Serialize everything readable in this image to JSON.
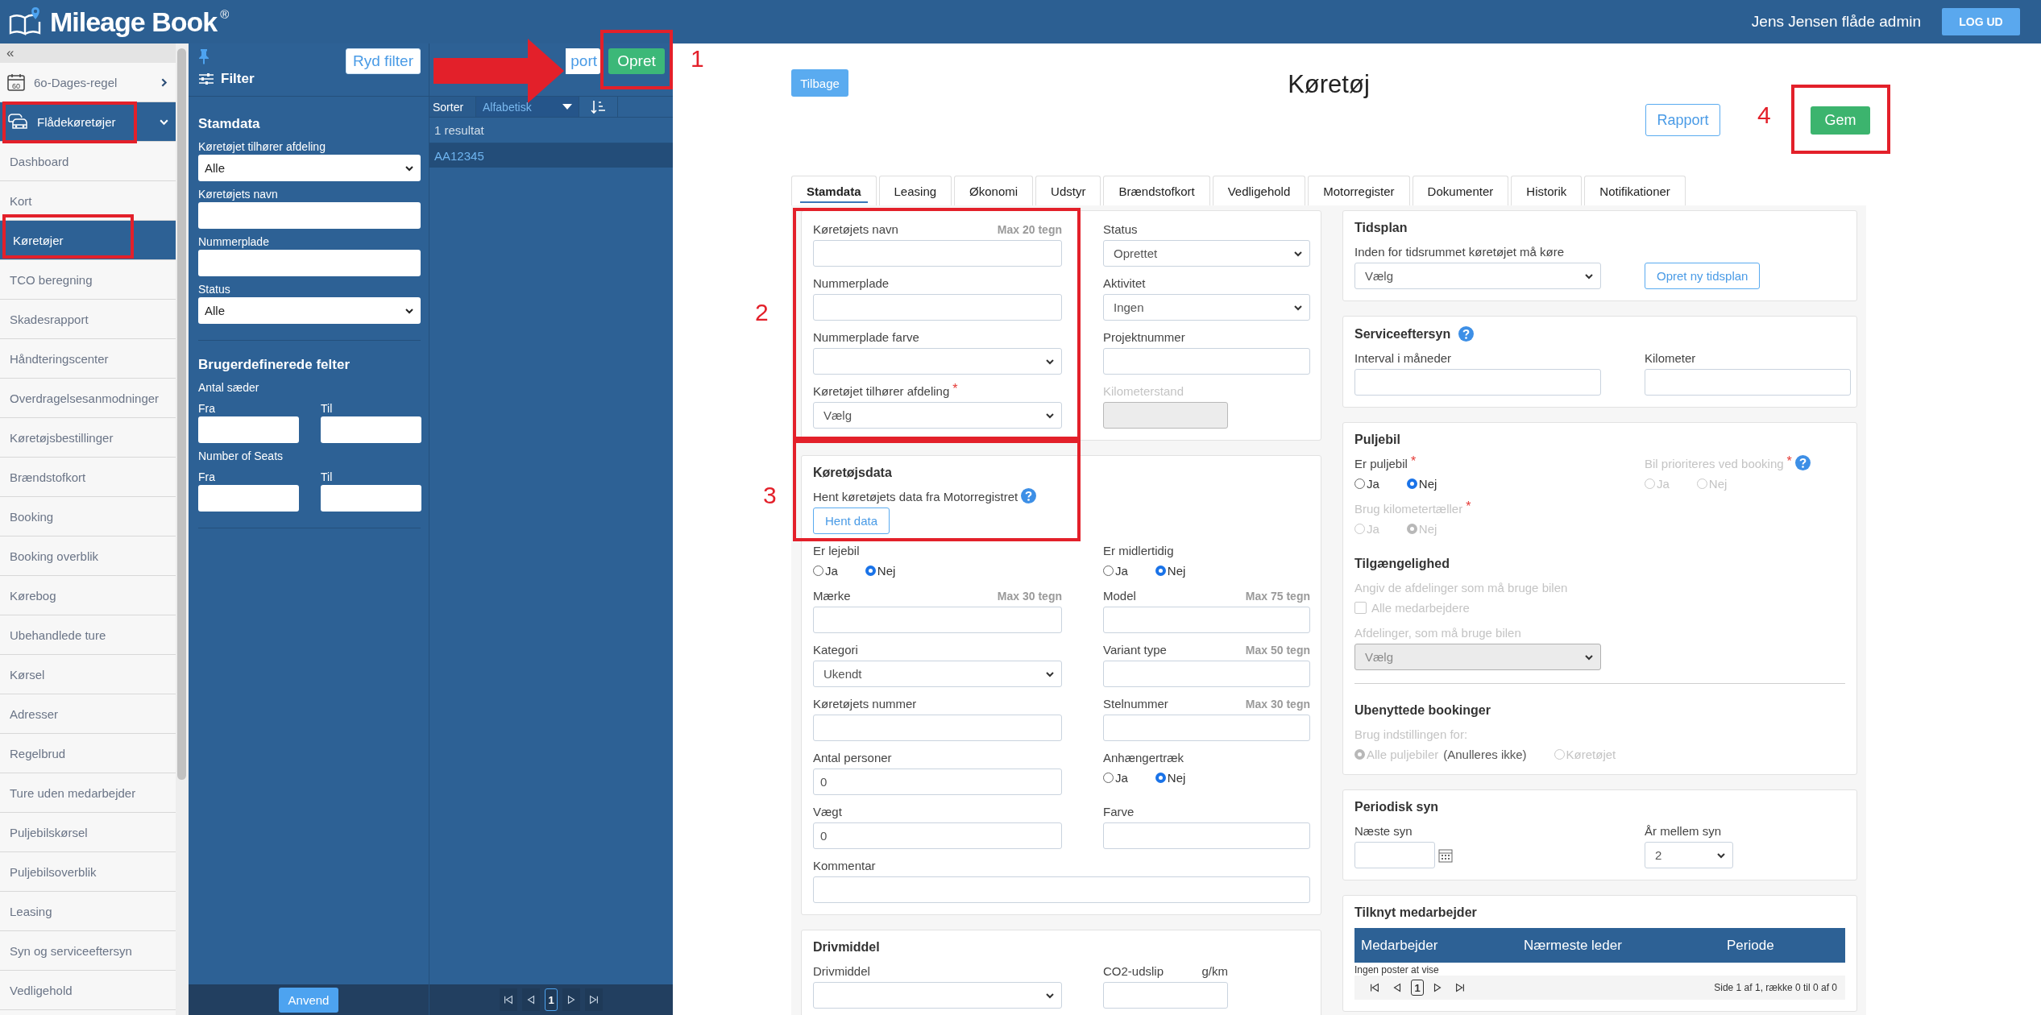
{
  "header": {
    "logo": "Mileage Book",
    "logo_mark": "®",
    "user": "Jens Jensen flåde admin",
    "logout": "LOG UD"
  },
  "sidebar": {
    "collapse": "«",
    "items": [
      {
        "kind": "group",
        "label": "6o-Dages-regel",
        "icon_text": "60",
        "expanded": false
      },
      {
        "kind": "group",
        "label": "Flådekøretøjer",
        "expanded": true
      },
      {
        "kind": "link",
        "label": "Dashboard",
        "selected": false
      },
      {
        "kind": "link",
        "label": "Kort",
        "selected": false
      },
      {
        "kind": "link",
        "label": "Køretøjer",
        "selected": true
      },
      {
        "kind": "link",
        "label": "TCO beregning",
        "selected": false
      },
      {
        "kind": "link",
        "label": "Skadesrapport",
        "selected": false
      },
      {
        "kind": "link",
        "label": "Håndteringscenter",
        "selected": false
      },
      {
        "kind": "link",
        "label": "Overdragelsesanmodninger",
        "selected": false
      },
      {
        "kind": "link",
        "label": "Køretøjsbestillinger",
        "selected": false
      },
      {
        "kind": "link",
        "label": "Brændstofkort",
        "selected": false
      },
      {
        "kind": "link",
        "label": "Booking",
        "selected": false
      },
      {
        "kind": "link",
        "label": "Booking overblik",
        "selected": false
      },
      {
        "kind": "link",
        "label": "Kørebog",
        "selected": false
      },
      {
        "kind": "link",
        "label": "Ubehandlede ture",
        "selected": false
      },
      {
        "kind": "link",
        "label": "Kørsel",
        "selected": false
      },
      {
        "kind": "link",
        "label": "Adresser",
        "selected": false
      },
      {
        "kind": "link",
        "label": "Regelbrud",
        "selected": false
      },
      {
        "kind": "link",
        "label": "Ture uden medarbejder",
        "selected": false
      },
      {
        "kind": "link",
        "label": "Puljebilskørsel",
        "selected": false
      },
      {
        "kind": "link",
        "label": "Puljebilsoverblik",
        "selected": false
      },
      {
        "kind": "link",
        "label": "Leasing",
        "selected": false
      },
      {
        "kind": "link",
        "label": "Syn og serviceeftersyn",
        "selected": false
      },
      {
        "kind": "link",
        "label": "Vedligehold",
        "selected": false
      }
    ]
  },
  "filter": {
    "clear": "Ryd filter",
    "title": "Filter",
    "sections": [
      {
        "title": "Stamdata",
        "fields": [
          {
            "kind": "select",
            "label": "Køretøjet tilhører afdeling",
            "value": "Alle"
          },
          {
            "kind": "text",
            "label": "Køretøjets navn"
          },
          {
            "kind": "text",
            "label": "Nummerplade"
          },
          {
            "kind": "select",
            "label": "Status",
            "value": "Alle"
          }
        ]
      },
      {
        "title": "Brugerdefinerede felter",
        "fields": [
          {
            "kind": "range",
            "label": "Antal sæder",
            "from": "Fra",
            "to": "Til"
          },
          {
            "kind": "range",
            "label": "Number of Seats",
            "from": "Fra",
            "to": "Til"
          }
        ]
      }
    ],
    "apply": "Anvend"
  },
  "results": {
    "export": "port",
    "create": "Opret",
    "sort_label": "Sorter",
    "sort_value": "Alfabetisk",
    "count": "1 resultat",
    "rows": [
      {
        "label": "AA12345",
        "selected": true
      }
    ],
    "page": "1"
  },
  "main": {
    "back": "Tilbage",
    "title": "Køretøj",
    "report": "Rapport",
    "save": "Gem",
    "tabs": [
      {
        "label": "Stamdata",
        "selected": true
      },
      {
        "label": "Leasing",
        "selected": false
      },
      {
        "label": "Økonomi",
        "selected": false
      },
      {
        "label": "Udstyr",
        "selected": false
      },
      {
        "label": "Brændstofkort",
        "selected": false
      },
      {
        "label": "Vedligehold",
        "selected": false
      },
      {
        "label": "Motorregister",
        "selected": false
      },
      {
        "label": "Dokumenter",
        "selected": false
      },
      {
        "label": "Historik",
        "selected": false
      },
      {
        "label": "Notifikationer",
        "selected": false
      }
    ],
    "left_cards": [
      {
        "rows": [
          {
            "kind": "fields",
            "fields": [
              {
                "kind": "text",
                "label": "Køretøjets navn",
                "hint": "Max 20 tegn"
              },
              {
                "kind": "select",
                "label": "Status",
                "value": "Oprettet"
              }
            ]
          },
          {
            "kind": "fields",
            "fields": [
              {
                "kind": "text",
                "label": "Nummerplade"
              },
              {
                "kind": "select",
                "label": "Aktivitet",
                "value": "Ingen"
              }
            ]
          },
          {
            "kind": "fields",
            "fields": [
              {
                "kind": "select",
                "label": "Nummerplade farve"
              },
              {
                "kind": "text",
                "label": "Projektnummer"
              }
            ]
          },
          {
            "kind": "fields",
            "fields": [
              {
                "kind": "select",
                "label": "Køretøjet tilhører afdeling",
                "required_mark": "*",
                "value": "Vælg"
              },
              {
                "kind": "text",
                "label": "Kilometerstand",
                "disabled": true,
                "short": true
              }
            ]
          }
        ]
      },
      {
        "title": "Køretøjsdata",
        "rows": [
          {
            "kind": "fields",
            "fields": [
              {
                "kind": "action",
                "label": "Hent køretøjets data fra Motorregistret",
                "help": true,
                "button": "Hent data"
              }
            ]
          },
          {
            "kind": "fields",
            "fields": [
              {
                "kind": "radio",
                "label": "Er lejebil",
                "options": [
                  {
                    "label": "Ja",
                    "selected": false
                  },
                  {
                    "label": "Nej",
                    "selected": true
                  }
                ]
              },
              {
                "kind": "radio",
                "label": "Er midlertidig",
                "options": [
                  {
                    "label": "Ja",
                    "selected": false
                  },
                  {
                    "label": "Nej",
                    "selected": true
                  }
                ]
              }
            ]
          },
          {
            "kind": "fields",
            "fields": [
              {
                "kind": "text",
                "label": "Mærke",
                "hint": "Max 30 tegn"
              },
              {
                "kind": "text",
                "label": "Model",
                "hint": "Max 75 tegn"
              }
            ]
          },
          {
            "kind": "fields",
            "fields": [
              {
                "kind": "select",
                "label": "Kategori",
                "value": "Ukendt"
              },
              {
                "kind": "text",
                "label": "Variant type",
                "hint": "Max 50 tegn"
              }
            ]
          },
          {
            "kind": "fields",
            "fields": [
              {
                "kind": "text",
                "label": "Køretøjets nummer"
              },
              {
                "kind": "text",
                "label": "Stelnummer",
                "hint": "Max 30 tegn"
              }
            ]
          },
          {
            "kind": "fields",
            "fields": [
              {
                "kind": "text",
                "label": "Antal personer",
                "value": "0"
              },
              {
                "kind": "radio",
                "label": "Anhængertræk",
                "options": [
                  {
                    "label": "Ja",
                    "selected": false
                  },
                  {
                    "label": "Nej",
                    "selected": true
                  }
                ]
              }
            ]
          },
          {
            "kind": "fields",
            "fields": [
              {
                "kind": "text",
                "label": "Vægt",
                "value": "0"
              },
              {
                "kind": "text",
                "label": "Farve"
              }
            ]
          },
          {
            "kind": "fields",
            "fields": [
              {
                "kind": "text",
                "label": "Kommentar"
              }
            ]
          }
        ]
      },
      {
        "title": "Drivmiddel",
        "rows": [
          {
            "kind": "fields",
            "fields": [
              {
                "kind": "select",
                "label": "Drivmiddel"
              },
              {
                "kind": "text",
                "label": "CO2-udslip",
                "unit": "g/km",
                "short": true
              }
            ]
          }
        ]
      }
    ],
    "right_cards": [
      {
        "title": "Tidsplan",
        "rows": [
          {
            "kind": "fields",
            "fields": [
              {
                "kind": "select",
                "label": "Inden for tidsrummet køretøjet må køre",
                "value": "Vælg"
              },
              {
                "kind": "button",
                "label": "Opret ny tidsplan"
              }
            ]
          }
        ]
      },
      {
        "title": "Serviceeftersyn",
        "help": true,
        "rows": [
          {
            "kind": "fields",
            "fields": [
              {
                "kind": "text",
                "label": "Interval i måneder"
              },
              {
                "kind": "text",
                "label": "Kilometer"
              }
            ]
          }
        ]
      },
      {
        "title": "Puljebil",
        "rows": [
          {
            "kind": "fields",
            "fields": [
              {
                "kind": "radio",
                "label": "Er puljebil",
                "required_mark": "*",
                "options": [
                  {
                    "label": "Ja",
                    "selected": false
                  },
                  {
                    "label": "Nej",
                    "selected": true
                  }
                ]
              },
              {
                "kind": "radio",
                "label": "Bil prioriteres ved booking",
                "required_mark": "*",
                "help": true,
                "disabled": true,
                "options": [
                  {
                    "label": "Ja",
                    "selected": false
                  },
                  {
                    "label": "Nej",
                    "selected": false
                  }
                ]
              }
            ]
          },
          {
            "kind": "fields",
            "fields": [
              {
                "kind": "radio",
                "label": "Brug kilometertæller",
                "required_mark": "*",
                "disabled": true,
                "options": [
                  {
                    "label": "Ja",
                    "selected": false
                  },
                  {
                    "label": "Nej",
                    "selected": true
                  }
                ]
              }
            ]
          },
          {
            "kind": "heading",
            "text": "Tilgængelighed"
          },
          {
            "kind": "fields",
            "fields": [
              {
                "kind": "checkbox",
                "label": "Angiv de afdelinger som må bruge bilen",
                "option": "Alle medarbejdere",
                "checked": false,
                "disabled": true
              }
            ]
          },
          {
            "kind": "fields",
            "fields": [
              {
                "kind": "select",
                "label": "Afdelinger, som må bruge bilen",
                "value": "Vælg",
                "disabled": true
              }
            ]
          },
          {
            "kind": "divider"
          },
          {
            "kind": "heading",
            "text": "Ubenyttede bookinger"
          },
          {
            "kind": "fields",
            "fields": [
              {
                "kind": "radio",
                "label": "Brug indstillingen for:",
                "disabled": true,
                "options": [
                  {
                    "label": "Alle puljebiler",
                    "suffix": "(Anulleres ikke)",
                    "selected": true
                  },
                  {
                    "label": "Køretøjet",
                    "selected": false
                  }
                ]
              }
            ]
          }
        ]
      },
      {
        "title": "Periodisk syn",
        "rows": [
          {
            "kind": "fields",
            "fields": [
              {
                "kind": "date",
                "label": "Næste syn"
              },
              {
                "kind": "select",
                "label": "År mellem syn",
                "value": "2",
                "short": true
              }
            ]
          }
        ]
      },
      {
        "title": "Tilknyt medarbejder",
        "rows": [
          {
            "kind": "table",
            "columns": [
              "Medarbejder",
              "Nærmeste leder",
              "Periode"
            ],
            "empty": "Ingen poster at vise",
            "page": "1",
            "info": "Side 1 af 1, række 0 til 0 af 0"
          }
        ]
      }
    ]
  },
  "annotations": {
    "markers": [
      "1",
      "2",
      "3",
      "4"
    ]
  }
}
